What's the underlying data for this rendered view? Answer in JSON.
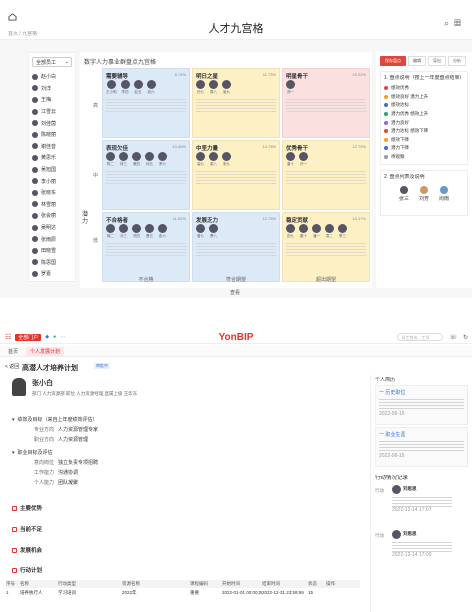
{
  "screen1": {
    "breadcrumb": "首页 / 九宫格",
    "title": "人才九宫格",
    "selector": "全部员工",
    "section_title": "数字人力事业群盘点九宫格",
    "axis_label": "潜力",
    "x_labels": [
      "不合格",
      "符合期望",
      "超出期望"
    ],
    "cells": [
      {
        "title": "需要辅导",
        "pct": "8.74%",
        "color": "#dce9f7",
        "avatars": [
          "王小明",
          "李四",
          "赵五",
          "钱六"
        ]
      },
      {
        "title": "明日之星",
        "pct": "11.73%",
        "color": "#fdf0c4",
        "avatars": [
          "孙七",
          "周八",
          "吴九"
        ]
      },
      {
        "title": "明星骨干",
        "pct": "15.22%",
        "color": "#fbe0e0",
        "avatars": [
          "郑一"
        ]
      },
      {
        "title": "表现欠佳",
        "pct": "10.49%",
        "color": "#dce9f7",
        "avatars": [
          "陈二",
          "林三",
          "黄四",
          "何五",
          "罗六"
        ]
      },
      {
        "title": "中坚力量",
        "pct": "14.73%",
        "color": "#fdf0c4",
        "avatars": [
          "高七",
          "梁八",
          "宋九"
        ]
      },
      {
        "title": "优秀骨干",
        "pct": "12.79%",
        "color": "#fdf0c4",
        "avatars": [
          "唐十",
          "许一"
        ]
      },
      {
        "title": "不合格者",
        "pct": "11.51%",
        "color": "#dce9f7",
        "avatars": [
          "韩二",
          "冯三",
          "邓四",
          "曹五",
          "彭六"
        ]
      },
      {
        "title": "发展乏力",
        "pct": "12.73%",
        "color": "#dce9f7",
        "avatars": [
          "曾七",
          "萧八"
        ]
      },
      {
        "title": "稳定贡献",
        "pct": "14.17%",
        "color": "#fdf0c4",
        "avatars": [
          "田九",
          "董十",
          "潘一",
          "袁二",
          "蔡三"
        ]
      }
    ],
    "detail_button": "查看",
    "people": [
      "赵小白",
      "刘洋",
      "王梅",
      "江雪云",
      "刘佳茵",
      "陈晓丽",
      "谢佳音",
      "黄思乐",
      "吴旭国",
      "李小丽",
      "张晓东",
      "林雪丽",
      "张会丽",
      "吴明达",
      "张雨辰",
      "田晓雪",
      "陈思国",
      "罗嘉"
    ],
    "right_buttons": [
      "保存盘点",
      "编辑",
      "导出",
      "分析"
    ],
    "legend_title": "1. 盘点说明（按上一年度盘点结果）",
    "legend": [
      {
        "label": "绩效优秀",
        "color": "#e0473c"
      },
      {
        "label": "绩效良好 潜力上升",
        "color": "#f0a020"
      },
      {
        "label": "绩效达标",
        "color": "#3a6fd8"
      },
      {
        "label": "潜力优秀 绩效上升",
        "color": "#29a36a"
      },
      {
        "label": "潜力良好",
        "color": "#8a6ad8"
      },
      {
        "label": "潜力达标 绩效下降",
        "color": "#e0473c"
      },
      {
        "label": "绩效下降",
        "color": "#f0a020"
      },
      {
        "label": "潜力下降",
        "color": "#3a6fd8"
      },
      {
        "label": "待观察",
        "color": "#999999"
      }
    ],
    "legend2_title": "2. 盘点列表及说明",
    "legend2_people": [
      "张三",
      "刘芳",
      "周雨"
    ]
  },
  "screen2": {
    "tab_label": "全部门户",
    "brand": "YonBIP",
    "search_placeholder": "员工姓名、工号",
    "tabs": [
      "首页",
      "个人发展计划"
    ],
    "back": "< 返回",
    "page_title": "高潜人才培养计划",
    "status": "审批中",
    "person_name": "张小白",
    "person_meta": "部门 人力资源部   职位 人力资源经理   直属上级 王华东",
    "sec1": "绩效及目标（来自上年度绩效评估）",
    "kv1": [
      {
        "k": "专业方向",
        "v": "人力资源管理专家"
      },
      {
        "k": "职业方向",
        "v": "人力资源管理"
      }
    ],
    "sec2": "职业目标及评估",
    "kv2": [
      {
        "k": "意向岗位",
        "v": "独立负责专项招聘"
      },
      {
        "k": "工作能力",
        "v": "沟通协调"
      },
      {
        "k": "个人能力",
        "v": "团队凝聚"
      }
    ],
    "sections": [
      "主要优势",
      "当前不足",
      "发展机会",
      "行动计划"
    ],
    "table_headers": [
      "序号",
      "名称",
      "行动类型",
      "资源名称",
      "课程编码",
      "开始时间",
      "结束时间",
      "状态",
      "操作"
    ],
    "table_row": [
      "1",
      "培养执行人",
      "学习培训",
      "2022年",
      "重要",
      "2022-01-01 00:00:00",
      "2022-12-31 23:59:59",
      "15",
      ""
    ],
    "right_title": "个人简历",
    "cards": [
      {
        "title": "一 历史职位",
        "text": "2022-06-15"
      },
      {
        "title": "一 职业生涯",
        "text": "2022-06-15"
      }
    ],
    "record_title": "行动情况记录",
    "records": [
      {
        "label": "行动",
        "name": "刘思思",
        "meta": "2022-12-14 17:07"
      },
      {
        "label": "行动",
        "name": "刘思思",
        "meta": "2022-12-14 17:09"
      }
    ]
  }
}
